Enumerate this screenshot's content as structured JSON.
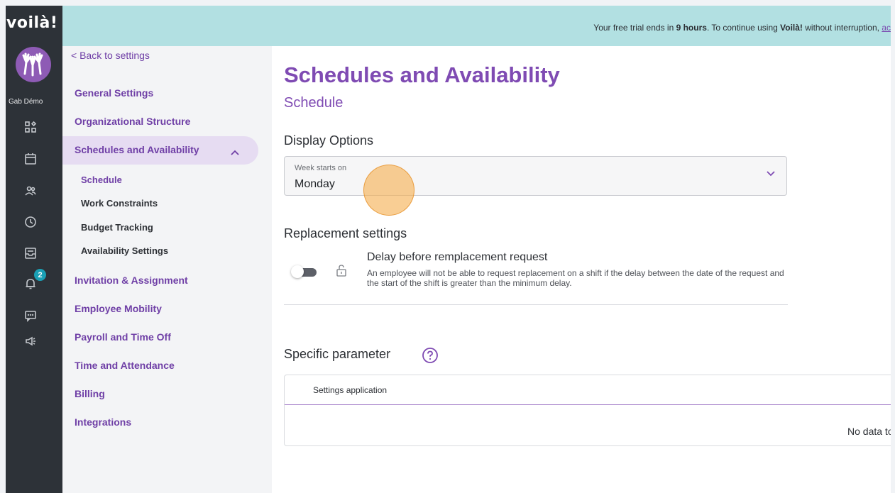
{
  "app": {
    "logo": "voilà!",
    "username": "Gab Démo"
  },
  "banner": {
    "prefix": "Your free trial ends in ",
    "time": "9 hours",
    "middle": ". To continue using ",
    "brand": "Voilà!",
    "suffix": " without interruption, ",
    "link": "ac"
  },
  "rail": {
    "icons": [
      "dashboard-icon",
      "calendar-icon",
      "people-icon",
      "clock-icon",
      "inbox-icon",
      "bell-icon",
      "chat-icon",
      "megaphone-icon"
    ],
    "notification_count": "2"
  },
  "settings_nav": {
    "back": "< Back to settings",
    "items": [
      {
        "label": "General Settings"
      },
      {
        "label": "Organizational Structure"
      },
      {
        "label": "Schedules and Availability",
        "expanded": true
      },
      {
        "label": "Invitation & Assignment"
      },
      {
        "label": "Employee Mobility"
      },
      {
        "label": "Payroll and Time Off"
      },
      {
        "label": "Time and Attendance"
      },
      {
        "label": "Billing"
      },
      {
        "label": "Integrations"
      }
    ],
    "subitems": [
      {
        "label": "Schedule",
        "active": true
      },
      {
        "label": "Work Constraints"
      },
      {
        "label": "Budget Tracking"
      },
      {
        "label": "Availability Settings"
      }
    ]
  },
  "main": {
    "title": "Schedules and Availability",
    "subtitle": "Schedule",
    "display_options": {
      "heading": "Display Options",
      "week_label": "Week starts on",
      "week_value": "Monday"
    },
    "replacement": {
      "heading": "Replacement settings",
      "toggle_on": false,
      "title": "Delay before remplacement request",
      "description": "An employee will not be able to request replacement on a shift if the delay between the date of the request and the start of the shift is greater than the minimum delay."
    },
    "specific": {
      "heading": "Specific parameter",
      "column": "Settings application",
      "empty": "No data to"
    }
  },
  "colors": {
    "accent": "#7f4bb3",
    "banner": "#b2e0e2",
    "rail": "#2d3238",
    "badge": "#1aa0b5"
  }
}
